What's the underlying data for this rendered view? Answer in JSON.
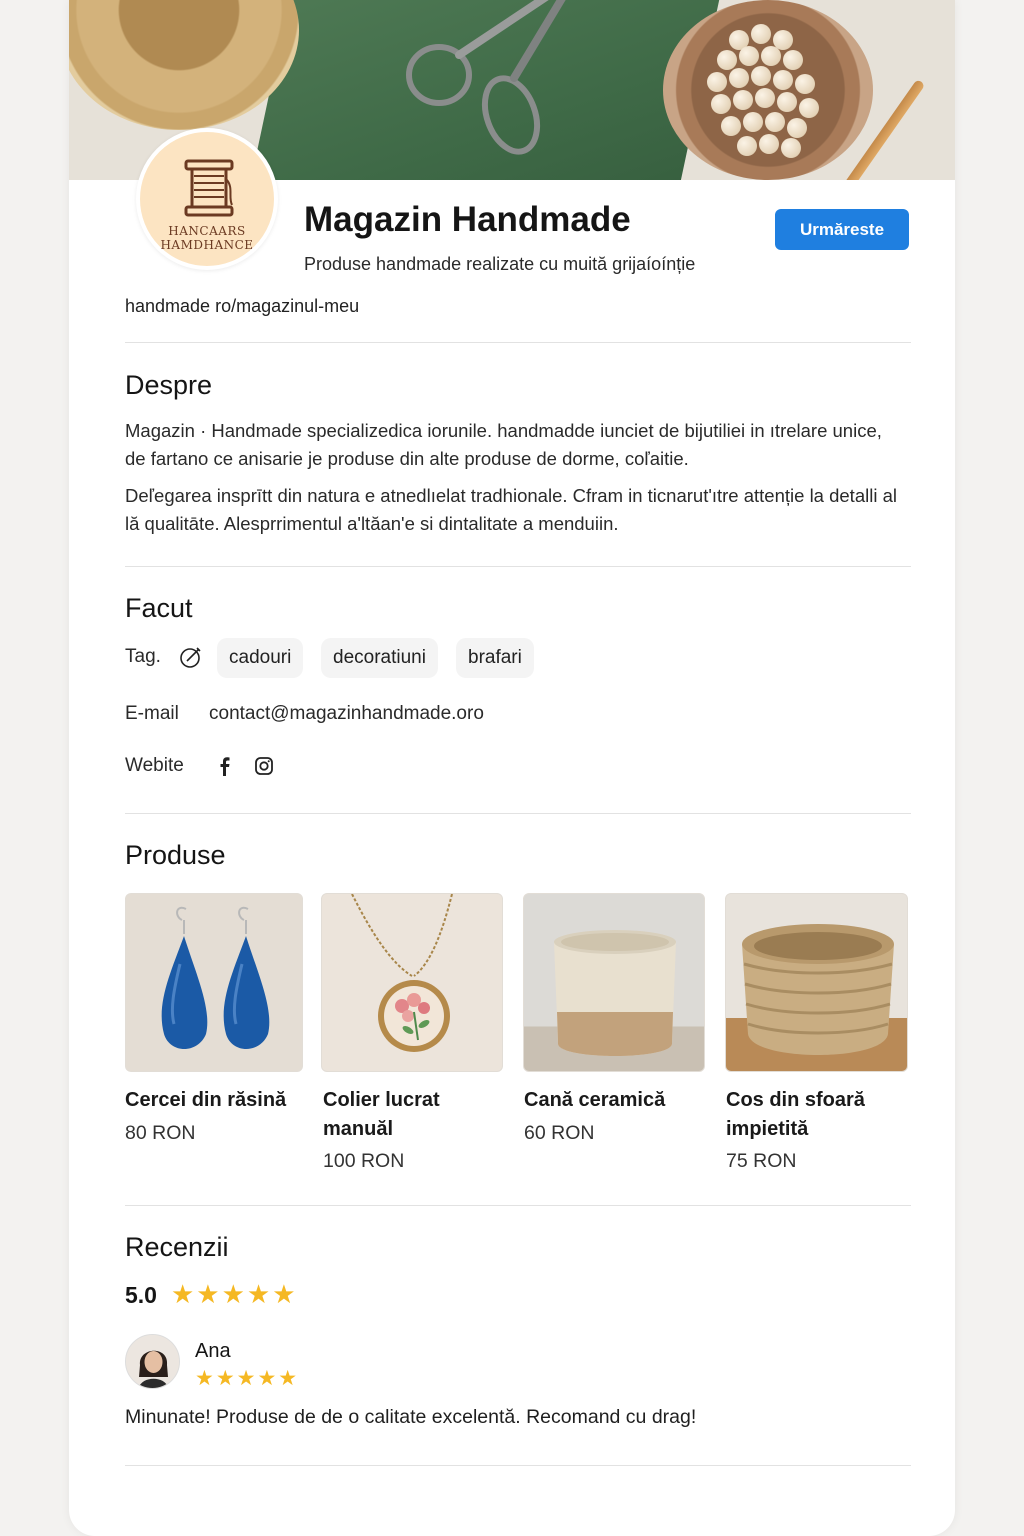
{
  "shop": {
    "logo_line1": "HANCAARS",
    "logo_line2": "HAMDHANCE",
    "title": "Magazin Handmade",
    "subtitle": "Produse handmade realizate cu muită grĳaíoínție",
    "follow_label": "Urmăreste",
    "url": "handmade ro/magazinul-meu"
  },
  "about": {
    "heading": "Despre",
    "para1": "Magazin · Handmade specializedica iorunile. handmadde iunciet de bijutiliei in ıtrelare unice, de fartano ce anisarie je produse din alte produse de dorme, coľaitie.",
    "para2": "Deľegarea insprītt din natura e atnedlıelat tradhionale. Cfram in ticnarut'ıtre attenție la detalli al lă qualitāte. Alesprrimentul a'ltăan'e si dintalitate a menduiin."
  },
  "facut": {
    "heading": "Facut",
    "tags_label": "Tag.",
    "tags": [
      "cadouri",
      "decoratiuni",
      "brafari"
    ],
    "email_label": "E-mail",
    "email": "contact@magazinhandmade.oro",
    "website_label": "Webite"
  },
  "products": {
    "heading": "Produse",
    "items": [
      {
        "name": "Cercei din răsină",
        "price": "80 RON"
      },
      {
        "name": "Colier lucrat manuăl",
        "price": "100 RON"
      },
      {
        "name": "Cană ceramică",
        "price": "60 RON"
      },
      {
        "name": "Cos din sfoară impietită",
        "price": "75 RON"
      }
    ]
  },
  "reviews": {
    "heading": "Recenzii",
    "score": "5.0",
    "score_stars": "★★★★★",
    "items": [
      {
        "name": "Ana",
        "stars": "★★★★★",
        "text": "Minunate! Produse de de o calitate excelentă. Recomand cu drag!"
      }
    ]
  },
  "colors": {
    "accent": "#1f7fe0",
    "star": "#f5b823"
  }
}
